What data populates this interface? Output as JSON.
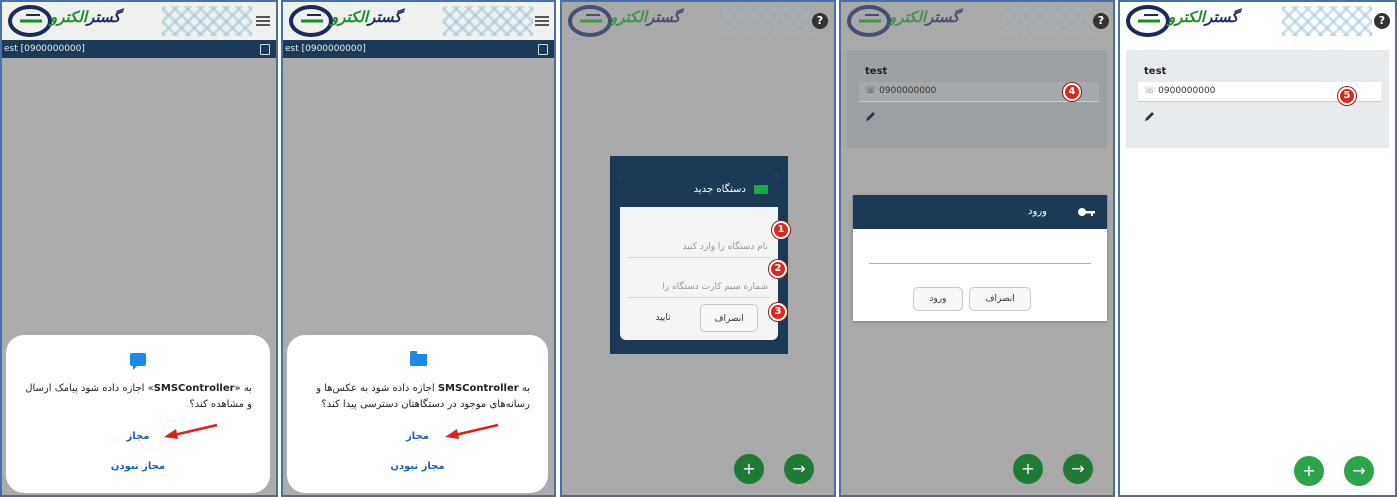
{
  "app": {
    "logo_text": "الکترو",
    "logo_text2": "گستر"
  },
  "panel1": {
    "subbar": "est  [0900000000]",
    "perm_text_prefix": "به «",
    "perm_app": "SMSController",
    "perm_text_suffix": "» اجازه داده شود پیامک ارسال و مشاهده کند؟",
    "allow": "مجاز",
    "deny": "مجاز نبودن"
  },
  "panel2": {
    "subbar": "est  [0900000000]",
    "perm_text_prefix": "به ",
    "perm_app": "SMSController",
    "perm_text_suffix": " اجازه داده شود به عکس‌ها و رسانه‌های موجود در دستگاهتان دسترسی پیدا کند؟",
    "allow": "مجاز",
    "deny": "مجاز نبودن"
  },
  "panel3": {
    "dialog_title": "دستگاه جدید",
    "field_name_placeholder": "نام دستگاه را وارد کنید",
    "field_sim_placeholder": "شماره سیم کارت دستگاه را",
    "cancel": "انصراف",
    "ok": "تایید",
    "badges": [
      "1",
      "2",
      "3"
    ]
  },
  "panel4": {
    "name": "test",
    "phone": "0900000000",
    "badge": "4",
    "login_title": "ورود",
    "login_button": "ورود",
    "cancel_button": "انصراف"
  },
  "panel5": {
    "name": "test",
    "phone": "0900000000",
    "badge": "5"
  },
  "colors": {
    "header_blue": "#1c3a55",
    "fab_green": "#2ea34a",
    "badge_red": "#d52b1e",
    "link_blue": "#1a5fb4"
  }
}
